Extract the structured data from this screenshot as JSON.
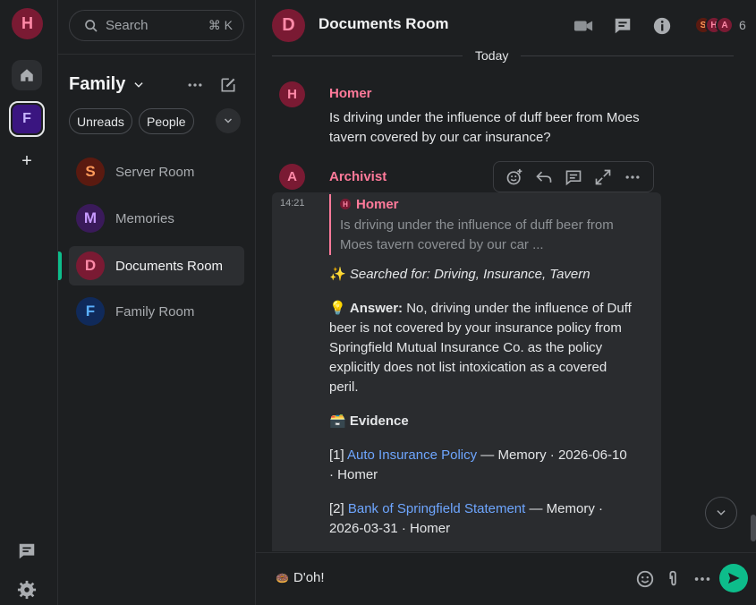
{
  "rail": {
    "user_initial": "H",
    "space_initial": "F"
  },
  "roomlist": {
    "search_label": "Search",
    "search_shortcut": "⌘ K",
    "space_name": "Family",
    "chips": [
      "Unreads",
      "People"
    ],
    "rooms": [
      {
        "initial": "S",
        "name": "Server Room",
        "avatar_bg": "#5a1a10",
        "avatar_fg": "#ff9a5a"
      },
      {
        "initial": "M",
        "name": "Memories",
        "avatar_bg": "#3a1a5a",
        "avatar_fg": "#c79aff"
      },
      {
        "initial": "D",
        "name": "Documents Room",
        "avatar_bg": "#7a1a33",
        "avatar_fg": "#ff8aa8"
      },
      {
        "initial": "F",
        "name": "Family Room",
        "avatar_bg": "#102a5a",
        "avatar_fg": "#5ab0ff"
      }
    ]
  },
  "header": {
    "avatar_initial": "D",
    "title": "Documents Room",
    "faces": [
      "S",
      "H",
      "A"
    ],
    "member_count": "6"
  },
  "timeline": {
    "date_label": "Today",
    "event1": {
      "avatar_initial": "H",
      "sender": "Homer",
      "text": "Is driving under the influence of duff beer from Moes tavern covered by our car insurance?"
    },
    "event2": {
      "avatar_initial": "A",
      "sender": "Archivist",
      "timestamp": "14:21",
      "quote_initial": "H",
      "quote_sender": "Homer",
      "quote_text": "Is driving under the influence of duff beer from Moes tavern covered by our car ...",
      "searched_emoji": "✨",
      "searched_text": "Searched for: Driving, Insurance, Tavern",
      "answer_emoji": "💡",
      "answer_label": "Answer:",
      "answer_text": "No, driving under the influence of Duff beer is not covered by your insurance policy from Springfield Mutual Insurance Co. as the policy explicitly does not list intoxication as a covered peril.",
      "evidence_emoji": "🗃️",
      "evidence_label": "Evidence",
      "evidence": [
        {
          "num": "[1]",
          "title": "Auto Insurance Policy",
          "meta": " — Memory · 2026-06-10 · Homer"
        },
        {
          "num": "[2]",
          "title": "Bank of Springfield Statement",
          "meta": " — Memory · 2026-03-31 · Homer"
        }
      ]
    }
  },
  "composer": {
    "emoji": "🍩",
    "text": "D'oh!"
  },
  "colors": {
    "accent": "#0dbd8b",
    "sender": "#ff7a9a",
    "link": "#6ea6ff"
  }
}
